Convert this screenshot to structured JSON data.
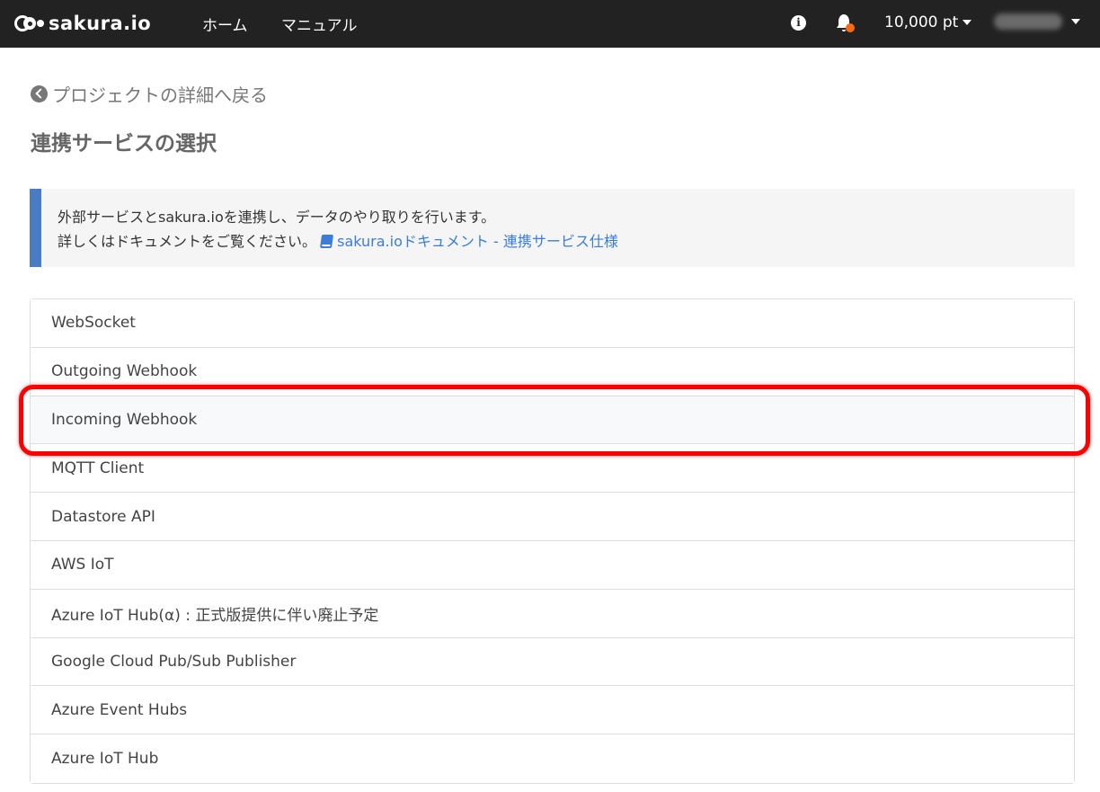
{
  "navbar": {
    "logo_text": "sakura.io",
    "home": "ホーム",
    "manual": "マニュアル",
    "info_icon": "info-icon",
    "bell_icon": "bell-icon",
    "points": "10,000 pt"
  },
  "back_link": "プロジェクトの詳細へ戻る",
  "page_title": "連携サービスの選択",
  "callout": {
    "line1": "外部サービスとsakura.ioを連携し、データのやり取りを行います。",
    "line2": "詳しくはドキュメントをご覧ください。",
    "doc_link": "sakura.ioドキュメント - 連携サービス仕様"
  },
  "services": [
    "WebSocket",
    "Outgoing Webhook",
    "Incoming Webhook",
    "MQTT Client",
    "Datastore API",
    "AWS IoT",
    "Azure IoT Hub(α) : 正式版提供に伴い廃止予定",
    "Google Cloud Pub/Sub Publisher",
    "Azure Event Hubs",
    "Azure IoT Hub"
  ],
  "colors": {
    "navbar_bg": "#222222",
    "accent": "#4a7cc4",
    "link": "#3b7dd8",
    "notification_dot": "#ff6a13",
    "highlight": "#ff0000"
  }
}
